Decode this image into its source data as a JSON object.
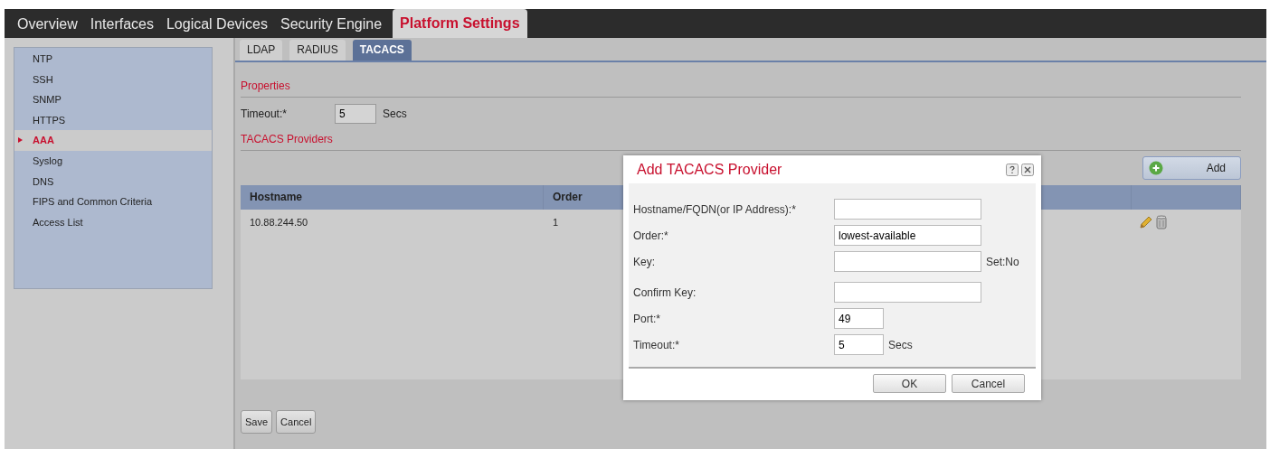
{
  "nav_tabs": [
    {
      "label": "Overview",
      "selected": false
    },
    {
      "label": "Interfaces",
      "selected": false
    },
    {
      "label": "Logical Devices",
      "selected": false
    },
    {
      "label": "Security Engine",
      "selected": false
    },
    {
      "label": "Platform Settings",
      "selected": true
    }
  ],
  "sidebar": {
    "items": [
      {
        "label": "NTP",
        "selected": false
      },
      {
        "label": "SSH",
        "selected": false
      },
      {
        "label": "SNMP",
        "selected": false
      },
      {
        "label": "HTTPS",
        "selected": false
      },
      {
        "label": "AAA",
        "selected": true
      },
      {
        "label": "Syslog",
        "selected": false
      },
      {
        "label": "DNS",
        "selected": false
      },
      {
        "label": "FIPS and Common Criteria",
        "selected": false
      },
      {
        "label": "Access List",
        "selected": false
      }
    ]
  },
  "sub_tabs": [
    {
      "label": "LDAP",
      "selected": false
    },
    {
      "label": "RADIUS",
      "selected": false
    },
    {
      "label": "TACACS",
      "selected": true
    }
  ],
  "properties": {
    "heading": "Properties",
    "timeout_label": "Timeout:*",
    "timeout_value": "5",
    "timeout_unit": "Secs"
  },
  "providers": {
    "heading": "TACACS Providers",
    "add_button": "Add",
    "table": {
      "columns": [
        "Hostname",
        "Order"
      ],
      "rows": [
        {
          "hostname": "10.88.244.50",
          "order": "1"
        }
      ]
    }
  },
  "footer_buttons": [
    "Save",
    "Cancel"
  ],
  "dialog": {
    "title": "Add TACACS Provider",
    "fields": [
      {
        "label": "Hostname/FQDN(or IP Address):*",
        "kind": "wide"
      },
      {
        "label": "Order:*",
        "kind": "wide",
        "value": "lowest-available"
      },
      {
        "label": "Key:",
        "kind": "wide",
        "suffix": "Set:No"
      },
      {
        "label": "Confirm Key:",
        "kind": "wide"
      },
      {
        "label": "Port:*",
        "kind": "short",
        "value": "49"
      },
      {
        "label": "Timeout:*",
        "kind": "short",
        "value": "5",
        "suffix": "Secs"
      }
    ],
    "buttons": [
      "OK",
      "Cancel"
    ]
  }
}
